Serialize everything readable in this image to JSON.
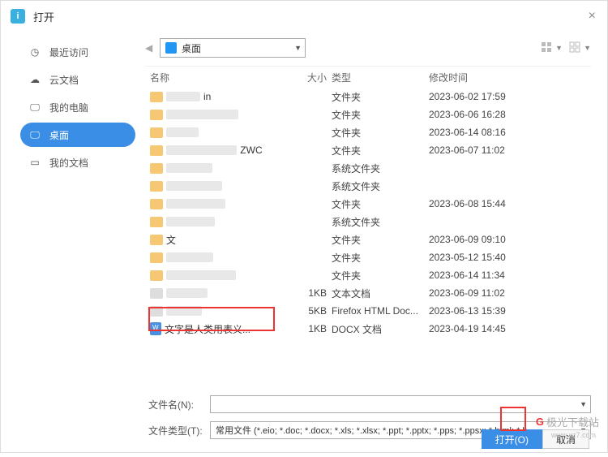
{
  "titlebar": {
    "title": "打开"
  },
  "sidebar": {
    "items": [
      {
        "label": "最近访问",
        "icon": "clock-icon"
      },
      {
        "label": "云文档",
        "icon": "cloud-icon"
      },
      {
        "label": "我的电脑",
        "icon": "monitor-icon"
      },
      {
        "label": "桌面",
        "icon": "monitor-icon",
        "selected": true
      },
      {
        "label": "我的文档",
        "icon": "folder-icon"
      }
    ]
  },
  "path": {
    "current": "桌面"
  },
  "columns": {
    "name": "名称",
    "size": "大小",
    "type": "类型",
    "modified": "修改时间"
  },
  "rows": [
    {
      "name_redacted": true,
      "name": "in",
      "size": "",
      "type": "文件夹",
      "modified": "2023-06-02 17:59",
      "icon": "folder"
    },
    {
      "name_redacted": true,
      "name": "",
      "size": "",
      "type": "文件夹",
      "modified": "2023-06-06 16:28",
      "icon": "folder"
    },
    {
      "name_redacted": true,
      "name": "",
      "size": "",
      "type": "文件夹",
      "modified": "2023-06-14 08:16",
      "icon": "folder"
    },
    {
      "name_redacted": true,
      "name": "ZWC",
      "size": "",
      "type": "文件夹",
      "modified": "2023-06-07 11:02",
      "icon": "folder"
    },
    {
      "name_redacted": true,
      "name": "",
      "size": "",
      "type": "系统文件夹",
      "modified": "",
      "icon": "folder"
    },
    {
      "name_redacted": true,
      "name": "",
      "size": "",
      "type": "系统文件夹",
      "modified": "",
      "icon": "folder"
    },
    {
      "name_redacted": true,
      "name": "",
      "size": "",
      "type": "文件夹",
      "modified": "2023-06-08 15:44",
      "icon": "folder"
    },
    {
      "name_redacted": true,
      "name": "",
      "size": "",
      "type": "系统文件夹",
      "modified": "",
      "icon": "folder"
    },
    {
      "name_redacted": false,
      "name": "文",
      "size": "",
      "type": "文件夹",
      "modified": "2023-06-09 09:10",
      "icon": "folder"
    },
    {
      "name_redacted": true,
      "name": "",
      "size": "",
      "type": "文件夹",
      "modified": "2023-05-12 15:40",
      "icon": "folder"
    },
    {
      "name_redacted": true,
      "name": "",
      "size": "",
      "type": "文件夹",
      "modified": "2023-06-14 11:34",
      "icon": "folder"
    },
    {
      "name_redacted": true,
      "name": "",
      "size": "1KB",
      "type": "文本文档",
      "modified": "2023-06-09 11:02",
      "icon": "file"
    },
    {
      "name_redacted": true,
      "name": "",
      "size": "5KB",
      "type": "Firefox HTML Doc...",
      "modified": "2023-06-13 15:39",
      "icon": "file"
    },
    {
      "name_redacted": false,
      "name": "文字是人类用表义...",
      "size": "1KB",
      "type": "DOCX 文档",
      "modified": "2023-04-19 14:45",
      "icon": "docx",
      "highlighted": true
    }
  ],
  "footer": {
    "filename_label": "文件名(N):",
    "filetype_label": "文件类型(T):",
    "filename_value": "",
    "filetype_value": "常用文件 (*.eio; *.doc; *.docx; *.xls; *.xlsx; *.ppt; *.pptx; *.pps; *.ppsx; *.html; *.h...",
    "open_btn": "打开(O)",
    "cancel_btn": "取消"
  },
  "watermark": {
    "text": "极光下载站",
    "url": "www.xz7.com"
  }
}
